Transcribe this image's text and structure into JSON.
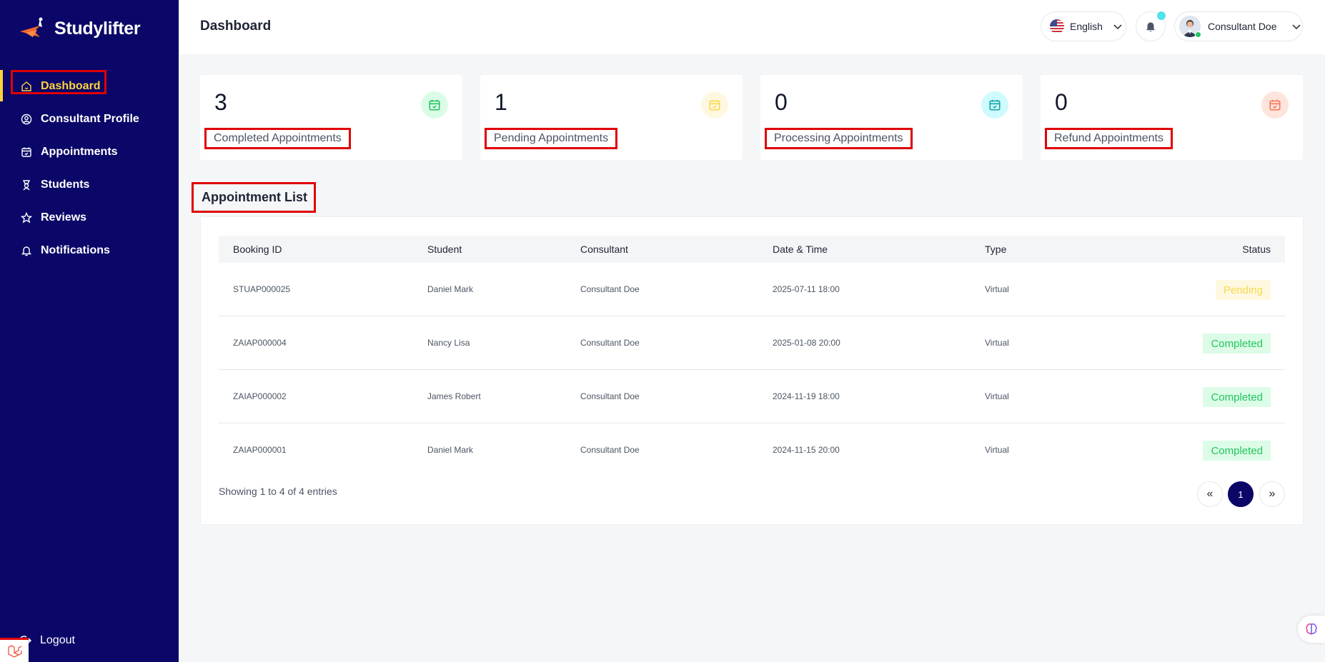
{
  "brand": {
    "name": "Studylifter"
  },
  "sidebar": {
    "items": [
      {
        "label": "Dashboard",
        "icon": "home-icon",
        "active": true
      },
      {
        "label": "Consultant Profile",
        "icon": "user-circle-icon"
      },
      {
        "label": "Appointments",
        "icon": "calendar-icon"
      },
      {
        "label": "Students",
        "icon": "student-icon"
      },
      {
        "label": "Reviews",
        "icon": "star-icon"
      },
      {
        "label": "Notifications",
        "icon": "bell-icon"
      }
    ],
    "logout_label": "Logout"
  },
  "header": {
    "title": "Dashboard",
    "language": "English",
    "user_name": "Consultant Doe"
  },
  "stats": [
    {
      "value": "3",
      "label": "Completed Appointments",
      "icon_color": "#22c55e",
      "icon_bg": "#dcfce7"
    },
    {
      "value": "1",
      "label": "Pending Appointments",
      "icon_color": "#f8d94a",
      "icon_bg": "#fff8e1"
    },
    {
      "value": "0",
      "label": "Processing Appointments",
      "icon_color": "#0ea5a5",
      "icon_bg": "#cffafe"
    },
    {
      "value": "0",
      "label": "Refund Appointments",
      "icon_color": "#f97355",
      "icon_bg": "#fde4dc"
    }
  ],
  "appointments": {
    "title": "Appointment List",
    "columns": [
      "Booking ID",
      "Student",
      "Consultant",
      "Date & Time",
      "Type",
      "Status"
    ],
    "rows": [
      {
        "booking_id": "STUAP000025",
        "student": "Daniel Mark",
        "consultant": "Consultant Doe",
        "datetime": "2025-07-11 18:00",
        "type": "Virtual",
        "status": "Pending"
      },
      {
        "booking_id": "ZAIAP000004",
        "student": "Nancy Lisa",
        "consultant": "Consultant Doe",
        "datetime": "2025-01-08 20:00",
        "type": "Virtual",
        "status": "Completed"
      },
      {
        "booking_id": "ZAIAP000002",
        "student": "James Robert",
        "consultant": "Consultant Doe",
        "datetime": "2024-11-19 18:00",
        "type": "Virtual",
        "status": "Completed"
      },
      {
        "booking_id": "ZAIAP000001",
        "student": "Daniel Mark",
        "consultant": "Consultant Doe",
        "datetime": "2024-11-15 20:00",
        "type": "Virtual",
        "status": "Completed"
      }
    ],
    "entries_text": "Showing 1 to 4 of 4 entries",
    "pagination": {
      "prev": "«",
      "current": "1",
      "next": "»"
    }
  },
  "colors": {
    "sidebar_bg": "#0a0768",
    "active_accent": "#ffd43b",
    "highlight_box": "#e00000"
  }
}
